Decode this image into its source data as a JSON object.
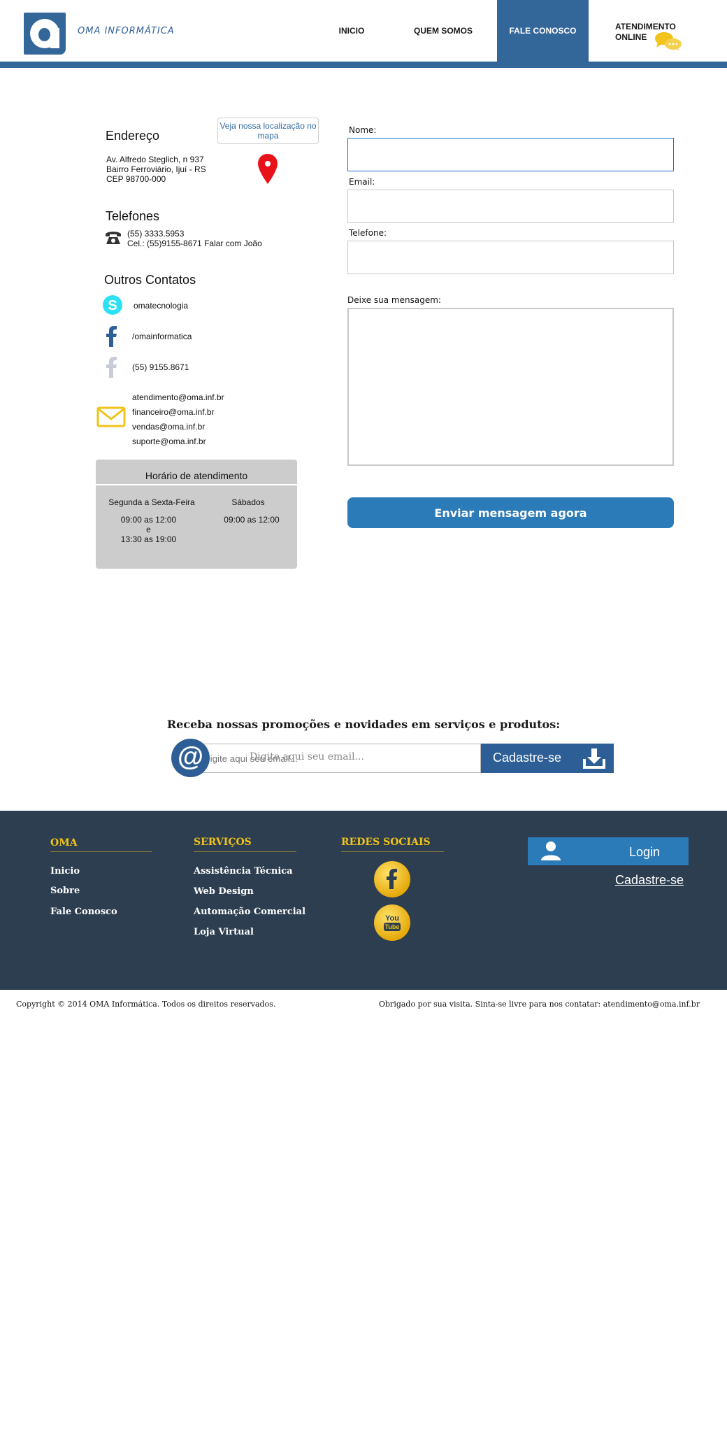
{
  "header": {
    "brand": "OMA INFORMÁTICA",
    "nav": {
      "inicio": "INICIO",
      "quem_somos": "QUEM SOMOS",
      "fale_conosco": "FALE CONOSCO",
      "online_line1": "ATENDIMENTO",
      "online_line2": "ONLINE"
    },
    "colors": {
      "brand": "#336699",
      "accent": "#f2c318"
    }
  },
  "address": {
    "title": "Endereço",
    "line1": "Av. Alfredo Steglich, n 937",
    "line2": "Bairro Ferroviário, Ijuí - RS",
    "line3": "CEP 98700-000",
    "map_button": "Veja nossa localização no mapa"
  },
  "phones": {
    "title": "Telefones",
    "line1": "(55) 3333.5953",
    "line2": "Cel.: (55)9155-8671 Falar com João"
  },
  "other_contacts": {
    "title": "Outros Contatos",
    "skype": "omatecnologia",
    "facebook": "/omainformatica",
    "phone": "(55) 9155.8671",
    "emails": [
      "atendimento@oma.inf.br",
      "financeiro@oma.inf.br",
      "vendas@oma.inf.br",
      "suporte@oma.inf.br"
    ]
  },
  "hours": {
    "title": "Horário de atendimento",
    "weekday_label": "Segunda a Sexta-Feira",
    "weekday_line1": "09:00 as 12:00",
    "weekday_line2": "e",
    "weekday_line3": "13:30 as 19:00",
    "saturday_label": "Sábados",
    "saturday_line1": "09:00 as 12:00"
  },
  "form": {
    "name_label": "Nome:",
    "email_label": "Email:",
    "phone_label": "Telefone:",
    "message_label": "Deixe sua mensagem:",
    "name_value": "",
    "email_value": "",
    "phone_value": "",
    "message_value": "",
    "submit": "Enviar mensagem agora"
  },
  "newsletter": {
    "title": "Receba nossas promoções e novidades em serviços e produtos:",
    "placeholder": "Digite aqui seu email...",
    "button": "Cadastre-se"
  },
  "footer": {
    "col1": {
      "title": "OMA",
      "links": [
        "Inicio",
        "Sobre",
        "Fale Conosco"
      ]
    },
    "col2": {
      "title": "SERVIÇOS",
      "links": [
        "Assistência Técnica",
        "Web Design",
        "Automação Comercial",
        "Loja Virtual"
      ]
    },
    "col3": {
      "title": "REDES SOCIAIS",
      "youtube_line1": "You",
      "youtube_line2": "Tube"
    },
    "login": "Login",
    "register": "Cadastre-se"
  },
  "bottom": {
    "copyright": "Copyright © 2014 OMA Informática. Todos os direitos reservados.",
    "thanks": "Obrigado por sua visita. Sinta-se livre para nos contatar: atendimento@oma.inf.br"
  }
}
